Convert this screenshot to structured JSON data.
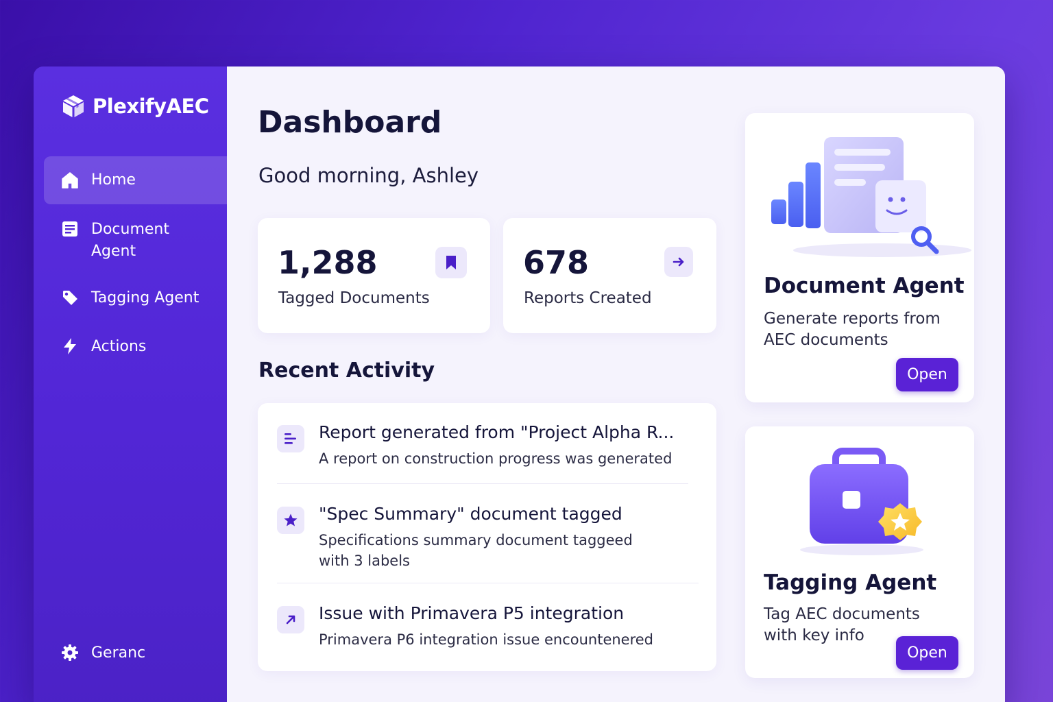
{
  "brand": {
    "name": "PlexifyAEC",
    "icon": "cube-icon"
  },
  "sidebar": {
    "items": [
      {
        "label": "Home",
        "icon": "home-icon",
        "active": true
      },
      {
        "label": "Document\nAgent",
        "icon": "document-icon",
        "active": false
      },
      {
        "label": "Tagging Agent",
        "icon": "tag-icon",
        "active": false
      },
      {
        "label": "Actions",
        "icon": "lightning-icon",
        "active": false
      }
    ],
    "settings": {
      "label": "Geranc",
      "icon": "gear-icon"
    }
  },
  "main": {
    "title": "Dashboard",
    "greeting": "Good morning, Ashley",
    "stats": [
      {
        "value": "1,288",
        "label": "Tagged Documents",
        "icon": "bookmark-icon"
      },
      {
        "value": "678",
        "label": "Reports Created",
        "icon": "arrow-right-icon"
      }
    ],
    "recent_activity": {
      "title": "Recent Activity",
      "items": [
        {
          "title": "Report generated from \"Project Alpha R...",
          "description": "A report on construction progress was generated",
          "icon": "list-icon"
        },
        {
          "title": "\"Spec Summary\" document tagged",
          "description": "Specifications summary document taggeed with 3 labels",
          "icon": "star-icon"
        },
        {
          "title": "Issue with Primavera P5 integration",
          "description": "Primavera P6 integration issue encountenered",
          "icon": "arrow-up-right-icon"
        }
      ]
    }
  },
  "agents": [
    {
      "title": "Document Agent",
      "description": "Generate reports from AEC documents",
      "button": "Open",
      "illustration": "report-chart-illustration"
    },
    {
      "title": "Tagging Agent",
      "description": "Tag AEC documents with key info",
      "button": "Open",
      "illustration": "briefcase-star-illustration"
    }
  ],
  "colors": {
    "accent": "#5a22d6",
    "sidebar": "#5226d6",
    "background": "#f5f3fd",
    "text": "#15153a"
  }
}
